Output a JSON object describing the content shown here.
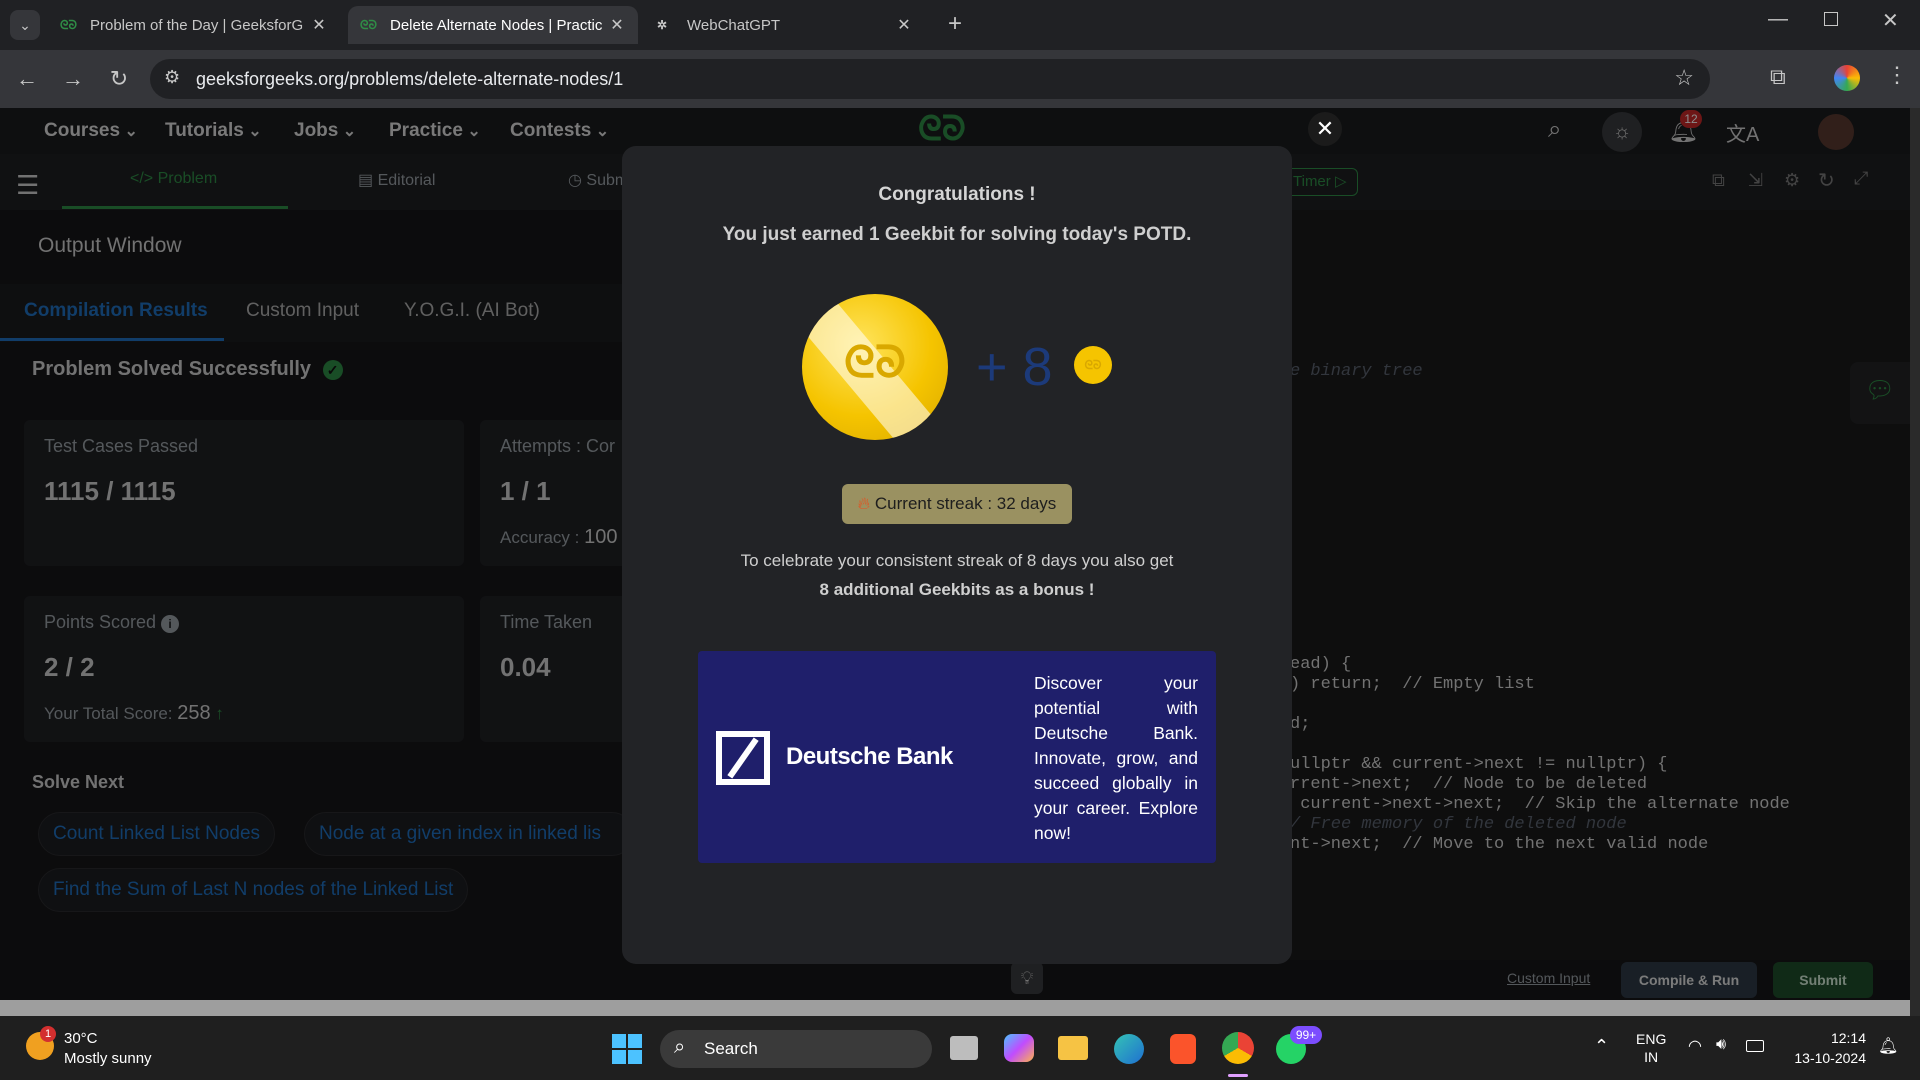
{
  "browser": {
    "tabs": [
      {
        "title": "Problem of the Day | GeeksforG",
        "favicon": "gfg-logo-icon"
      },
      {
        "title": "Delete Alternate Nodes | Practic",
        "favicon": "gfg-logo-icon"
      },
      {
        "title": "WebChatGPT",
        "favicon": "openai-icon"
      }
    ],
    "url": "geeksforgeeks.org/problems/delete-alternate-nodes/1"
  },
  "gfg_nav": {
    "items": [
      "Courses",
      "Tutorials",
      "Jobs",
      "Practice",
      "Contests"
    ],
    "notification_count": "12"
  },
  "subnav": {
    "tabs": [
      "Problem",
      "Editorial",
      "Subm"
    ],
    "timer_label": "Timer"
  },
  "output": {
    "title": "Output Window",
    "tabs": [
      "Compilation Results",
      "Custom Input",
      "Y.O.G.I. (AI Bot)"
    ],
    "status": "Problem Solved Successfully",
    "test_cases_label": "Test Cases Passed",
    "test_cases_value": "1115 / 1115",
    "attempts_label": "Attempts : Cor",
    "attempts_value": "1 / 1",
    "accuracy_label": "Accuracy :",
    "accuracy_value": "100",
    "points_label": "Points Scored",
    "points_value": "2 / 2",
    "total_score_label": "Your Total Score:",
    "total_score_value": "258",
    "time_label": "Time Taken",
    "time_value": "0.04",
    "solve_next_title": "Solve Next",
    "solve_next": [
      "Count Linked List Nodes",
      "Node at a given index in linked lis",
      "Find the Sum of Last N nodes of the Linked List"
    ]
  },
  "editor": {
    "lines": [
      {
        "text": "e binary tree",
        "type": "cm"
      },
      {
        "text": "ead) {",
        "type": "tx"
      },
      {
        "text": ") return;  // Empty list",
        "type": "mix1"
      },
      {
        "text": "d;",
        "type": "tx"
      },
      {
        "text": "ullptr && current->next != nullptr) {",
        "type": "mix2"
      },
      {
        "text": "rrent->next;  // Node to be deleted",
        "type": "mix3"
      },
      {
        "text": " current->next->next;  // Skip the alternate node",
        "type": "mix4"
      },
      {
        "text": "/ Free memory of the deleted node",
        "type": "cm"
      },
      {
        "text": "nt->next;  // Move to the next valid node",
        "type": "mix5"
      }
    ],
    "custom_input": "Custom Input",
    "compile_run": "Compile & Run",
    "submit": "Submit"
  },
  "modal": {
    "title": "Congratulations !",
    "subtitle": "You just earned 1 Geekbit for solving today's POTD.",
    "plus_text": "+ 8",
    "streak": "Current streak : 32 days",
    "bonus_line1": "To celebrate your consistent streak of 8 days you also get",
    "bonus_line2": "8 additional Geekbits as a bonus !",
    "ad_brand": "Deutsche Bank",
    "ad_text": "Discover your potential with Deutsche Bank. Innovate, grow, and succeed globally in your career. Explore now!"
  },
  "taskbar": {
    "weather_temp": "30°C",
    "weather_desc": "Mostly sunny",
    "weather_badge": "1",
    "search": "Search",
    "whatsapp_badge": "99+",
    "lang": "ENG",
    "region": "IN",
    "time": "12:14",
    "date": "13-10-2024"
  },
  "colors": {
    "gfg_green": "#2f8d46",
    "coin_gold": "#f5c400",
    "ad_bg": "#1f1f6b",
    "streak_bg": "#9a9161"
  }
}
